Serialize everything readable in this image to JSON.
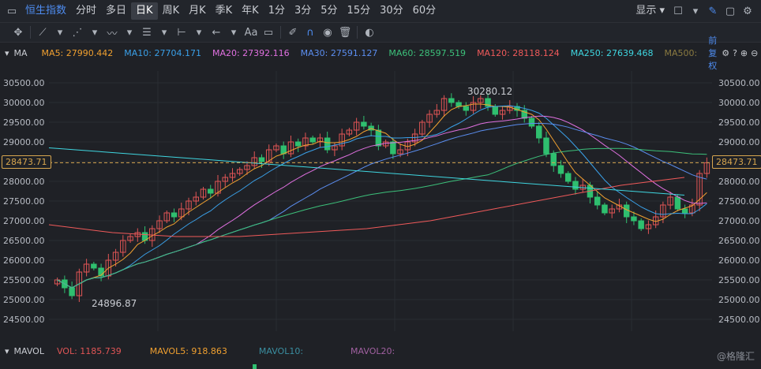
{
  "toolbar": {
    "index_name": "恒生指数",
    "periods": [
      "分时",
      "多日",
      "日K",
      "周K",
      "月K",
      "季K",
      "年K",
      "1分",
      "3分",
      "5分",
      "15分",
      "30分",
      "60分"
    ],
    "active_period": "日K",
    "display_label": "显示"
  },
  "ma": {
    "label": "MA",
    "items": [
      {
        "text": "MA5: 27990.442",
        "color": "#f0a030"
      },
      {
        "text": "MA10: 27704.171",
        "color": "#3aa0e8"
      },
      {
        "text": "MA20: 27392.116",
        "color": "#e070e0"
      },
      {
        "text": "MA30: 27591.127",
        "color": "#5b8ef0"
      },
      {
        "text": "MA60: 28597.519",
        "color": "#3cc07a"
      },
      {
        "text": "MA120: 28118.124",
        "color": "#f05a5a"
      },
      {
        "text": "MA250: 27639.468",
        "color": "#3fd6e0"
      },
      {
        "text": "MA500:",
        "color": "#8a7a40"
      }
    ],
    "adjust_label": "前复权"
  },
  "axis": {
    "y_ticks": [
      "30500.00",
      "30000.00",
      "29500.00",
      "29000.00",
      "28500.00",
      "28000.00",
      "27500.00",
      "27000.00",
      "26500.00",
      "26000.00",
      "25500.00",
      "25000.00",
      "24500.00"
    ],
    "y_tick_values": [
      30500,
      30000,
      29500,
      29000,
      28500,
      28000,
      27500,
      27000,
      26500,
      26000,
      25500,
      25000,
      24500
    ],
    "current_price": "28473.71",
    "current_value": 28473.71,
    "high_label": "30280.12",
    "high_value": 30280.12,
    "low_label": "24896.87",
    "low_value": 24896.87
  },
  "chart_data": {
    "type": "candlestick",
    "ylim": [
      24200,
      30800
    ],
    "closes": [
      25500,
      25300,
      25100,
      25700,
      25900,
      25800,
      25600,
      26000,
      26200,
      26500,
      26600,
      26700,
      26500,
      26800,
      27000,
      27200,
      27100,
      27300,
      27500,
      27600,
      27800,
      27700,
      28000,
      28100,
      28200,
      28300,
      28400,
      28600,
      28500,
      28800,
      28900,
      28700,
      29000,
      28900,
      29100,
      29000,
      29100,
      28800,
      28900,
      29200,
      29300,
      29500,
      29400,
      29300,
      28900,
      29000,
      28700,
      28800,
      29000,
      29200,
      29500,
      29700,
      29800,
      30100,
      30000,
      29900,
      29800,
      30000,
      30100,
      29900,
      29700,
      29800,
      29900,
      29800,
      29600,
      29400,
      29100,
      28700,
      28400,
      28200,
      28000,
      27800,
      27900,
      27600,
      27400,
      27200,
      27300,
      27400,
      27100,
      27000,
      26800,
      26900,
      27100,
      27400,
      27600,
      27300,
      27200,
      27400,
      28200,
      28470
    ],
    "volume_label": "VOL: 1185.739",
    "mavol5_label": "MAVOL5: 918.863",
    "mavol10_label": "MAVOL10:",
    "mavol20_label": "MAVOL20:"
  },
  "volbar": {
    "label": "MAVOL",
    "vol": "VOL: 1185.739",
    "mavol5": "MAVOL5: 918.863",
    "mavol10": "MAVOL10:",
    "mavol20": "MAVOL20:"
  },
  "watermark": "@格隆汇",
  "colors": {
    "up": "#e05555",
    "down": "#2fbf6f",
    "grid": "#2a2d33",
    "accent": "#4e8cf0"
  }
}
